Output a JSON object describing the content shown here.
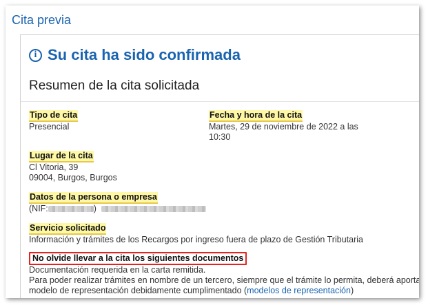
{
  "header": {
    "title": "Cita previa"
  },
  "confirmation": {
    "icon": "info-icon",
    "icon_glyph": "i",
    "message": "Su cita ha sido confirmada"
  },
  "summary": {
    "title": "Resumen de la cita solicitada"
  },
  "fields": {
    "tipo": {
      "label": "Tipo de cita",
      "value": "Presencial"
    },
    "fecha": {
      "label": "Fecha y hora de la cita",
      "value_line1": "Martes, 29 de noviembre de 2022 a las",
      "value_line2": "10:30"
    },
    "lugar": {
      "label": "Lugar de la cita",
      "line1": "Cl Vitoria, 39",
      "line2": "09004, Burgos, Burgos"
    },
    "datos": {
      "label": "Datos de la persona o empresa",
      "prefix": "(NIF:",
      "suffix": ")"
    },
    "servicio": {
      "label": "Servicio solicitado",
      "value": "Información y trámites de los Recargos por ingreso fuera de plazo de Gestión Tributaria"
    },
    "documentos": {
      "label": "No olvide llevar a la cita los siguientes documentos",
      "line1": "Documentación requerida en la carta remitida.",
      "line2": "Para poder realizar trámites en nombre de un tercero, siempre que el trámite lo permita, deberá aportar",
      "line3_prefix": "modelo de representación debidamente cumplimentado (",
      "link": "modelos de representación",
      "line3_suffix": ")"
    }
  },
  "colors": {
    "accent": "#1a63b0",
    "highlight": "#fdf7a6",
    "alert_border": "#e3231f"
  }
}
